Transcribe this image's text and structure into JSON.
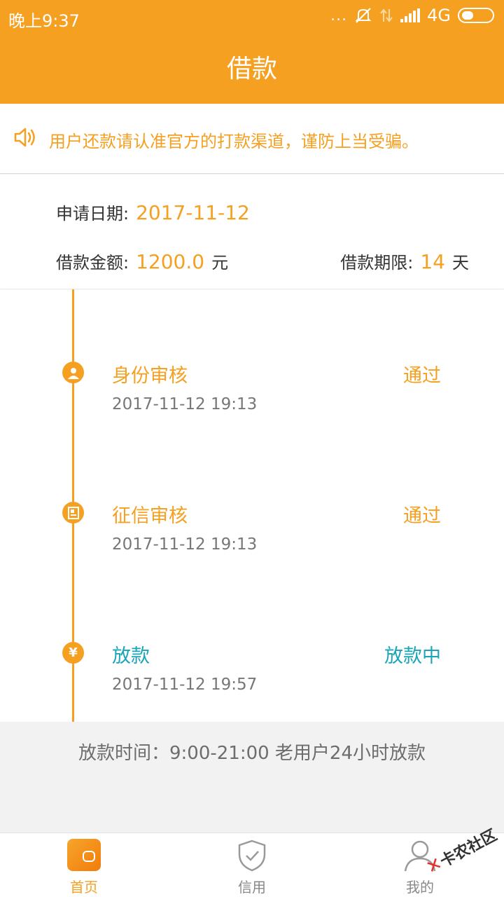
{
  "status_bar": {
    "time": "晚上9:37",
    "dots": "...",
    "network": "4G"
  },
  "header": {
    "title": "借款"
  },
  "notice": {
    "text": "用户还款请认准官方的打款渠道，谨防上当受骗。"
  },
  "info": {
    "apply_date_label": "申请日期:",
    "apply_date": "2017-11-12",
    "amount_label": "借款金额:",
    "amount": "1200.0",
    "amount_unit": "元",
    "term_label": "借款期限:",
    "term": "14",
    "term_unit": "天"
  },
  "timeline": [
    {
      "title": "身份审核",
      "status": "通过",
      "time": "2017-11-12 19:13",
      "icon": "user-icon"
    },
    {
      "title": "征信审核",
      "status": "通过",
      "time": "2017-11-12 19:13",
      "icon": "document-icon"
    },
    {
      "title": "放款",
      "status": "放款中",
      "time": "2017-11-12 19:57",
      "icon": "yen-icon",
      "yen": "¥"
    }
  ],
  "footer_note": "放款时间：9:00-21:00 老用户24小时放款",
  "nav": [
    {
      "label": "首页",
      "icon": "wallet-icon",
      "active": true
    },
    {
      "label": "信用",
      "icon": "shield-check-icon",
      "active": false
    },
    {
      "label": "我的",
      "icon": "person-icon",
      "active": false
    }
  ],
  "watermark": {
    "x": "✕",
    "text": "卡农社区"
  },
  "colors": {
    "accent": "#f5a021",
    "teal": "#1aa5b8"
  }
}
